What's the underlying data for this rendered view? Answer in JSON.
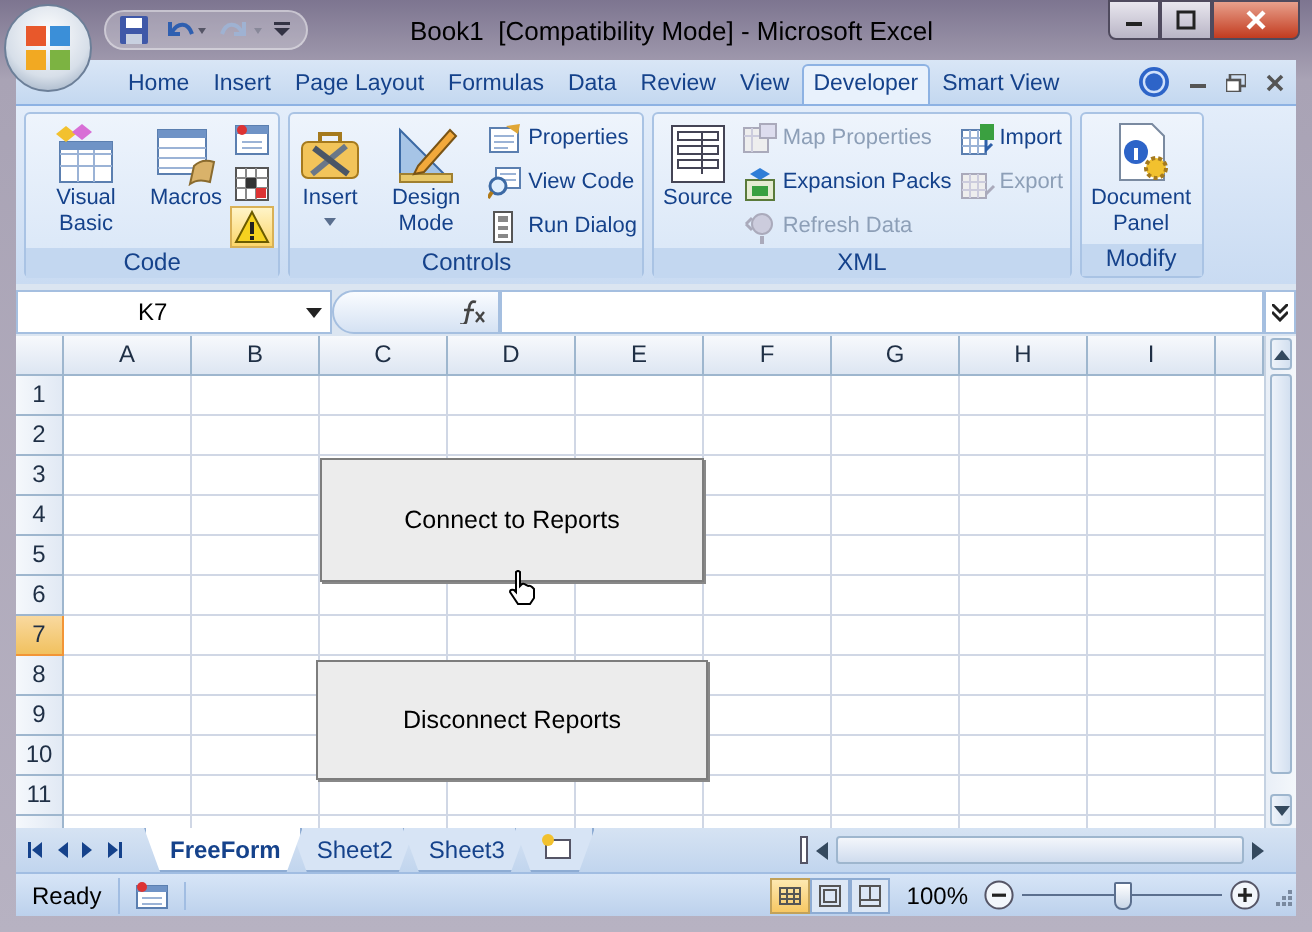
{
  "window": {
    "title": "Book1  [Compatibility Mode] - Microsoft Excel"
  },
  "ribbon_tabs": [
    {
      "label": "Home",
      "selected": false
    },
    {
      "label": "Insert",
      "selected": false
    },
    {
      "label": "Page Layout",
      "selected": false
    },
    {
      "label": "Formulas",
      "selected": false
    },
    {
      "label": "Data",
      "selected": false
    },
    {
      "label": "Review",
      "selected": false
    },
    {
      "label": "View",
      "selected": false
    },
    {
      "label": "Developer",
      "selected": true
    },
    {
      "label": "Smart View",
      "selected": false
    }
  ],
  "ribbon_groups": [
    {
      "label": "Code",
      "items": [
        {
          "kind": "large",
          "label": "Visual Basic"
        },
        {
          "kind": "large",
          "label": "Macros"
        },
        {
          "kind": "icon",
          "highlighted": false
        },
        {
          "kind": "icon",
          "highlighted": false
        },
        {
          "kind": "icon",
          "highlighted": true
        }
      ]
    },
    {
      "label": "Controls",
      "items": [
        {
          "kind": "large",
          "label": "Insert",
          "dropdown": true
        },
        {
          "kind": "large",
          "label": "Design Mode"
        },
        {
          "kind": "small",
          "label": "Properties",
          "disabled": false
        },
        {
          "kind": "small",
          "label": "View Code",
          "disabled": false
        },
        {
          "kind": "small",
          "label": "Run Dialog",
          "disabled": false
        }
      ]
    },
    {
      "label": "XML",
      "items": [
        {
          "kind": "large",
          "label": "Source"
        },
        {
          "kind": "small",
          "label": "Map Properties",
          "disabled": true
        },
        {
          "kind": "small",
          "label": "Expansion Packs",
          "disabled": false
        },
        {
          "kind": "small",
          "label": "Refresh Data",
          "disabled": true
        },
        {
          "kind": "small",
          "label": "Import",
          "disabled": false
        },
        {
          "kind": "small",
          "label": "Export",
          "disabled": true
        }
      ]
    },
    {
      "label": "Modify",
      "items": [
        {
          "kind": "large",
          "label": "Document Panel"
        }
      ]
    }
  ],
  "formula_bar": {
    "name_box": "K7"
  },
  "sheet": {
    "columns": [
      "A",
      "B",
      "C",
      "D",
      "E",
      "F",
      "G",
      "H",
      "I"
    ],
    "rows": [
      {
        "label": "1",
        "selected": false
      },
      {
        "label": "2",
        "selected": false
      },
      {
        "label": "3",
        "selected": false
      },
      {
        "label": "4",
        "selected": false
      },
      {
        "label": "5",
        "selected": false
      },
      {
        "label": "6",
        "selected": false
      },
      {
        "label": "7",
        "selected": true
      },
      {
        "label": "8",
        "selected": false
      },
      {
        "label": "9",
        "selected": false
      },
      {
        "label": "10",
        "selected": false
      },
      {
        "label": "11",
        "selected": false
      }
    ],
    "buttons": [
      {
        "label": "Connect to Reports"
      },
      {
        "label": "Disconnect Reports"
      }
    ]
  },
  "sheet_tabs": [
    {
      "label": "FreeForm",
      "selected": true
    },
    {
      "label": "Sheet2",
      "selected": false
    },
    {
      "label": "Sheet3",
      "selected": false
    }
  ],
  "status_bar": {
    "status": "Ready",
    "views": [
      {
        "selected": true
      },
      {
        "selected": false
      },
      {
        "selected": false
      }
    ],
    "zoom": "100%",
    "zoom_slider": {
      "level": 0.5
    }
  }
}
